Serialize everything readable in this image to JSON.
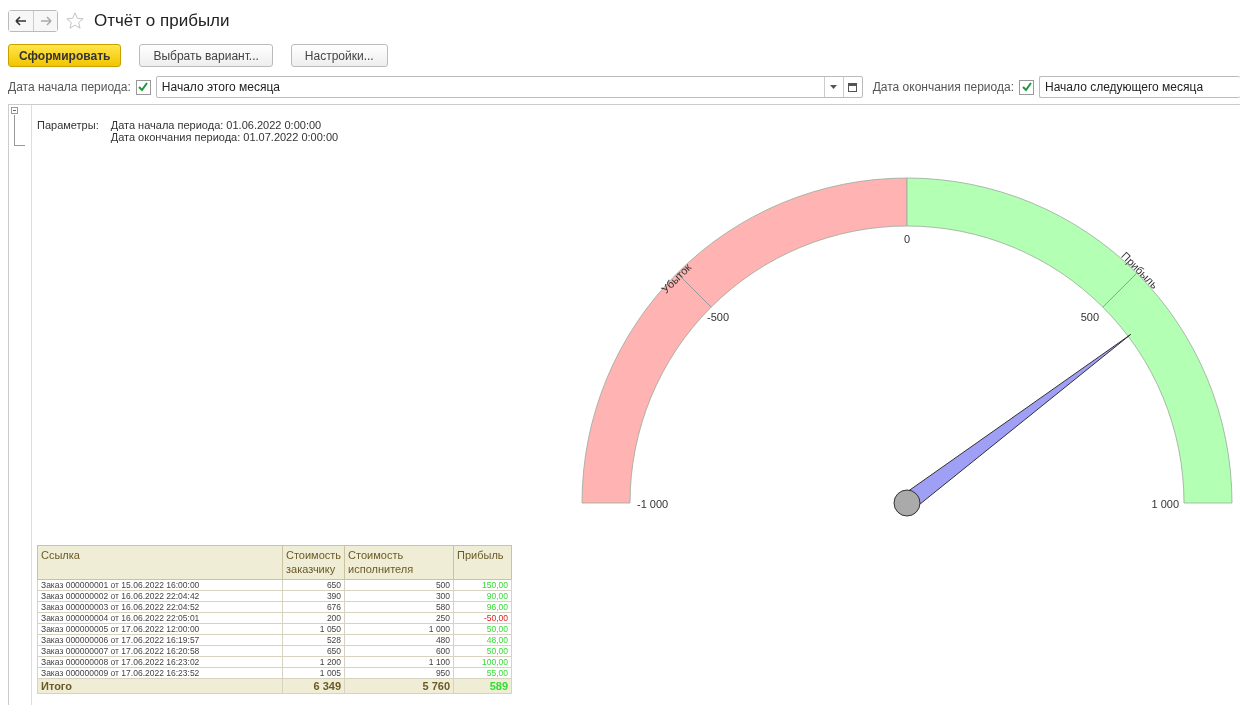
{
  "window": {
    "title": "Отчёт о прибыли",
    "favorite": false
  },
  "toolbar": {
    "buttons": [
      {
        "label": "Сформировать",
        "kind": "primary"
      },
      {
        "label": "Выбрать вариант...",
        "kind": "normal"
      },
      {
        "label": "Настройки...",
        "kind": "normal"
      }
    ]
  },
  "period": [
    {
      "label": "Дата начала периода:",
      "checked": true,
      "value": "Начало этого месяца",
      "kind": "dropdown"
    },
    {
      "label": "Дата окончания периода:",
      "checked": true,
      "value": "Начало следующего месяца",
      "kind": "plain"
    }
  ],
  "report": {
    "parameters": {
      "label": "Параметры:",
      "lines": [
        "Дата начала периода: 01.06.2022 0:00:00",
        "Дата окончания периода: 01.07.2022 0:00:00"
      ]
    },
    "gauge": {
      "zones": [
        {
          "label": "Убыток",
          "color": "#ffb3b3"
        },
        {
          "label": "Прибыль",
          "color": "#b3ffb3"
        }
      ],
      "ticks": [
        "-1 000",
        "-500",
        "0",
        "500",
        "1 000"
      ]
    },
    "table": {
      "columns": [
        "Ссылка",
        "Стоимость заказчику",
        "Стоимость исполнителя",
        "Прибыль"
      ],
      "rows": [
        {
          "ref": "Заказ 000000001 от 15.06.2022 16:00:00",
          "customer": "650",
          "contractor": "500",
          "profit": "150,00",
          "kind": "gain"
        },
        {
          "ref": "Заказ 000000002 от 16.06.2022 22:04:42",
          "customer": "390",
          "contractor": "300",
          "profit": "90,00",
          "kind": "gain"
        },
        {
          "ref": "Заказ 000000003 от 16.06.2022 22:04:52",
          "customer": "676",
          "contractor": "580",
          "profit": "96,00",
          "kind": "gain"
        },
        {
          "ref": "Заказ 000000004 от 16.06.2022 22:05:01",
          "customer": "200",
          "contractor": "250",
          "profit": "-50,00",
          "kind": "loss"
        },
        {
          "ref": "Заказ 000000005 от 17.06.2022 12:00:00",
          "customer": "1 050",
          "contractor": "1 000",
          "profit": "50,00",
          "kind": "gain"
        },
        {
          "ref": "Заказ 000000006 от 17.06.2022 16:19:57",
          "customer": "528",
          "contractor": "480",
          "profit": "48,00",
          "kind": "gain"
        },
        {
          "ref": "Заказ 000000007 от 17.06.2022 16:20:58",
          "customer": "650",
          "contractor": "600",
          "profit": "50,00",
          "kind": "gain"
        },
        {
          "ref": "Заказ 000000008 от 17.06.2022 16:23:02",
          "customer": "1 200",
          "contractor": "1 100",
          "profit": "100,00",
          "kind": "gain"
        },
        {
          "ref": "Заказ 000000009 от 17.06.2022 16:23:52",
          "customer": "1 005",
          "contractor": "950",
          "profit": "55,00",
          "kind": "gain"
        }
      ],
      "total": {
        "label": "Итого",
        "customer": "6 349",
        "contractor": "5 760",
        "profit": "589",
        "kind": "gain"
      }
    }
  }
}
